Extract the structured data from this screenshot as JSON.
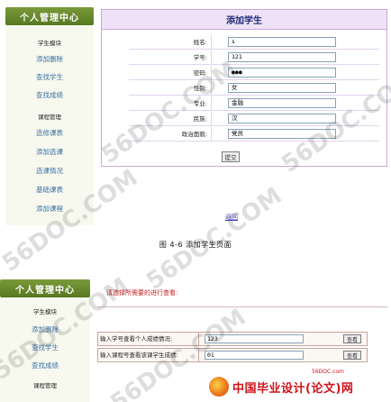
{
  "top": {
    "sidebar": {
      "title": "个人管理中心",
      "items": [
        {
          "label": "学生模块",
          "kind": "category"
        },
        {
          "label": "添加删除",
          "kind": "link"
        },
        {
          "label": "查找学生",
          "kind": "link"
        },
        {
          "label": "查找成绩",
          "kind": "link"
        },
        {
          "label": "课程管理",
          "kind": "category"
        },
        {
          "label": "选修课表",
          "kind": "link"
        },
        {
          "label": "添加选课",
          "kind": "link"
        },
        {
          "label": "选课情况",
          "kind": "link"
        },
        {
          "label": "基础课表",
          "kind": "link"
        },
        {
          "label": "添加课程",
          "kind": "link"
        }
      ]
    },
    "form": {
      "title": "添加学生",
      "fields": [
        {
          "label": "姓名:",
          "value": "s"
        },
        {
          "label": "学号:",
          "value": "121"
        },
        {
          "label": "密码:",
          "value": "●●●"
        },
        {
          "label": "性别:",
          "value": "女"
        },
        {
          "label": "专业:",
          "value": "金融"
        },
        {
          "label": "民族:",
          "value": "汉"
        },
        {
          "label": "政治面貌:",
          "value": "党员"
        }
      ],
      "submit_label": "提交",
      "return_label": "返回"
    },
    "caption": "图 4-6 添加学生页面"
  },
  "bottom": {
    "sidebar": {
      "title": "个人管理中心",
      "items": [
        {
          "label": "学生模块",
          "kind": "category"
        },
        {
          "label": "添加删除",
          "kind": "link"
        },
        {
          "label": "查找学生",
          "kind": "link"
        },
        {
          "label": "查找成绩",
          "kind": "link"
        },
        {
          "label": "课程管理",
          "kind": "category"
        }
      ]
    },
    "notice": "请选择所需要的进行查看:",
    "queries": [
      {
        "label": "输入学号查看个人成绩情况:",
        "value": "123",
        "button": "查看"
      },
      {
        "label": "输入课程号查看该课学生成绩:",
        "value": "01",
        "button": "查看"
      }
    ],
    "brand": {
      "text": "中国毕业设计(论文)网",
      "url": "56DOC.com"
    }
  },
  "watermarks": [
    "56DOC.COM",
    "56DOC.COM",
    "56DOC.COM",
    "56DOC.COM",
    "56DOC.COM",
    "56DOC.COM"
  ]
}
